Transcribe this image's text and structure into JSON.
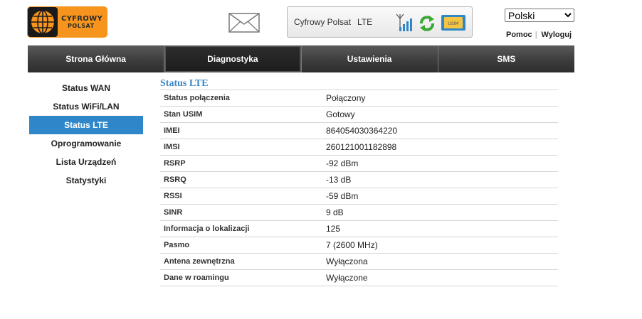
{
  "logo": {
    "brand_line1": "CYFROWY",
    "brand_line2": "POLSAT"
  },
  "status": {
    "operator": "Cyfrowy Polsat",
    "network": "LTE",
    "signal_bars": 4
  },
  "language": {
    "selected": "Polski"
  },
  "links": {
    "help": "Pomoc",
    "separator": "|",
    "logout": "Wyloguj"
  },
  "nav": {
    "tabs": [
      {
        "label": "Strona Główna"
      },
      {
        "label": "Diagnostyka"
      },
      {
        "label": "Ustawienia"
      },
      {
        "label": "SMS"
      }
    ],
    "active_index": 1
  },
  "sidebar": {
    "items": [
      {
        "label": "Status WAN"
      },
      {
        "label": "Status WiFi/LAN"
      },
      {
        "label": "Status LTE"
      },
      {
        "label": "Oprogramowanie"
      },
      {
        "label": "Lista Urządzeń"
      },
      {
        "label": "Statystyki"
      }
    ],
    "active_index": 2
  },
  "content": {
    "title": "Status LTE",
    "rows": [
      {
        "label": "Status połączenia",
        "value": "Połączony"
      },
      {
        "label": "Stan USIM",
        "value": "Gotowy"
      },
      {
        "label": "IMEI",
        "value": "864054030364220"
      },
      {
        "label": "IMSI",
        "value": "260121001182898"
      },
      {
        "label": "RSRP",
        "value": "-92 dBm"
      },
      {
        "label": "RSRQ",
        "value": "-13 dB"
      },
      {
        "label": "RSSI",
        "value": "-59 dBm"
      },
      {
        "label": "SINR",
        "value": "9 dB"
      },
      {
        "label": "Informacja o lokalizacji",
        "value": "125"
      },
      {
        "label": "Pasmo",
        "value": "7 (2600 MHz)"
      },
      {
        "label": "Antena zewnętrzna",
        "value": "Wyłączona"
      },
      {
        "label": "Dane w roamingu",
        "value": "Wyłączone"
      }
    ]
  },
  "colors": {
    "accent": "#2f86c9",
    "logo_orange": "#f7941d",
    "title_blue": "#3a87c5",
    "refresh_green": "#3aa935"
  },
  "icons": {
    "mail": "envelope-icon",
    "signal": "signal-strength-icon",
    "refresh": "refresh-icon",
    "sim": "sim-card-icon"
  }
}
